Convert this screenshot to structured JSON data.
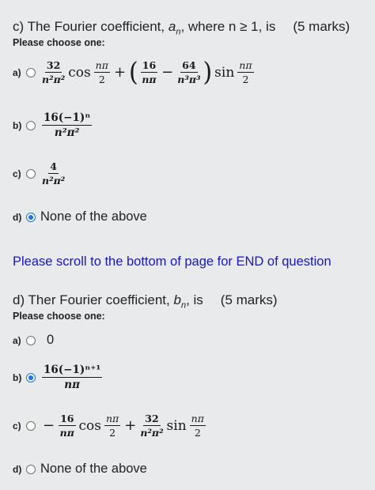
{
  "colors": {
    "background": "#e9eaeb",
    "link_blue": "#1717c8",
    "radio_selected": "#1a73e8"
  },
  "q1": {
    "title_prefix": "c) The Fourier coefficient, ",
    "title_var": "a",
    "title_sub": "n",
    "title_suffix": ", where n ≥ 1, is",
    "marks": "(5 marks)",
    "choose": "Please choose one:",
    "options": [
      {
        "letter": "a)",
        "checked": false
      },
      {
        "letter": "b)",
        "checked": false
      },
      {
        "letter": "c)",
        "checked": false
      },
      {
        "letter": "d)",
        "checked": true,
        "text": "None of the above"
      }
    ],
    "math": {
      "a_f1_num": "32",
      "a_f1_den": "n²π²",
      "a_cos": "cos",
      "a_f2_num": "nπ",
      "a_f2_den": "2",
      "a_plus": "+",
      "a_f3_num": "16",
      "a_f3_den": "nπ",
      "a_minus": "−",
      "a_f4_num": "64",
      "a_f4_den": "n³π³",
      "a_sin": "sin",
      "a_f5_num": "nπ",
      "a_f5_den": "2",
      "b_num": "16(−1)ⁿ",
      "b_den": "n²π²",
      "c_num": "4",
      "c_den": "n²π²"
    }
  },
  "scroll_note": "Please scroll to the bottom of page for END of question",
  "q2": {
    "title_prefix": "d) Ther Fourier coefficient, ",
    "title_var": "b",
    "title_sub": "n",
    "title_suffix": ", is",
    "marks": "(5 marks)",
    "choose": "Please choose one:",
    "options": [
      {
        "letter": "a)",
        "checked": false,
        "text": "0"
      },
      {
        "letter": "b)",
        "checked": true
      },
      {
        "letter": "c)",
        "checked": false
      },
      {
        "letter": "d)",
        "checked": false,
        "text": "None of the above"
      }
    ],
    "math": {
      "b_num": "16(−1)ⁿ⁺¹",
      "b_den": "nπ",
      "c_minus": "−",
      "c_f1_num": "16",
      "c_f1_den": "nπ",
      "c_cos": "cos",
      "c_f2_num": "nπ",
      "c_f2_den": "2",
      "c_plus": "+",
      "c_f3_num": "32",
      "c_f3_den": "n²π²",
      "c_sin": "sin",
      "c_f4_num": "nπ",
      "c_f4_den": "2"
    }
  }
}
